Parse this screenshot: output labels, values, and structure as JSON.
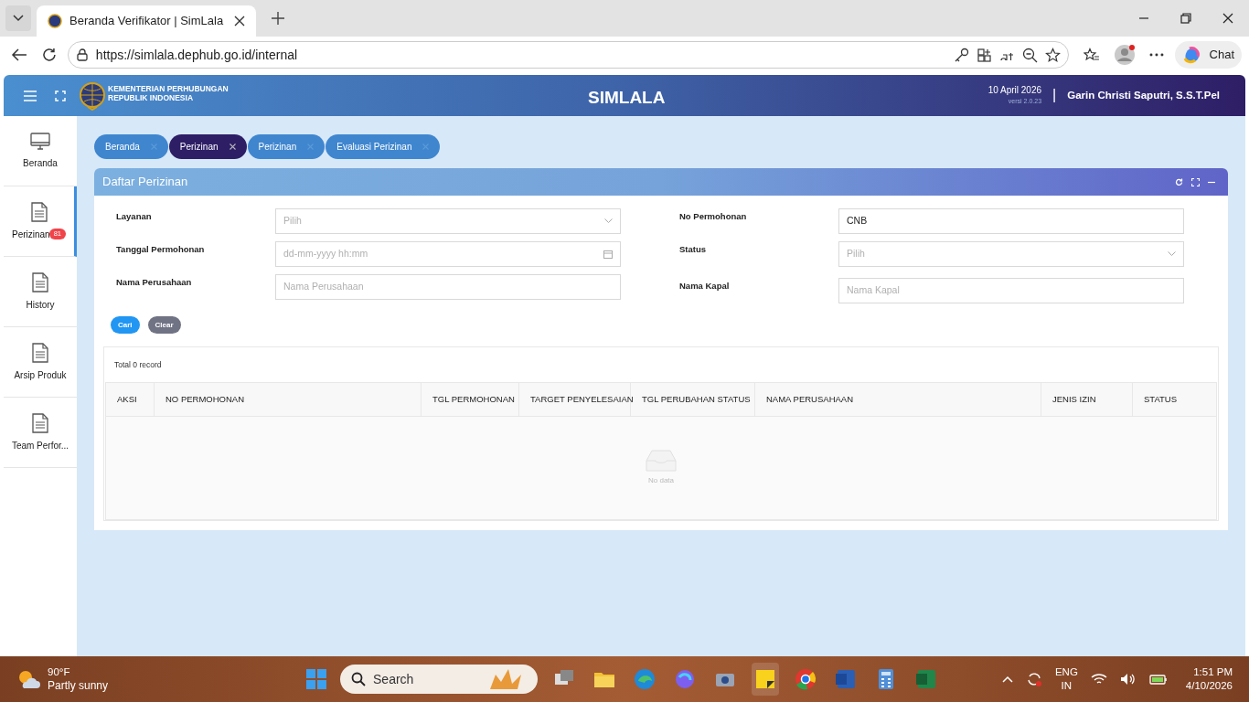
{
  "browser": {
    "tab_title": "Beranda Verifikator | SimLala",
    "url": "https://simlala.dephub.go.id/internal",
    "chat_label": "Chat"
  },
  "header": {
    "org_line1": "KEMENTERIAN PERHUBUNGAN",
    "org_line2": "REPUBLIK INDONESIA",
    "app_title": "SIMLALA",
    "date": "10 April 2026",
    "version": "versi 2.0.23",
    "separator": "|",
    "user": "Garin Christi Saputri, S.S.T.Pel"
  },
  "sidebar": {
    "items": [
      {
        "label": "Beranda",
        "kind": "monitor",
        "selected": false
      },
      {
        "label": "Perizinan",
        "kind": "document",
        "selected": true,
        "badge": "81"
      },
      {
        "label": "History",
        "kind": "document",
        "selected": false
      },
      {
        "label": "Arsip Produk",
        "kind": "document",
        "selected": false
      },
      {
        "label": "Team Perfor...",
        "kind": "document",
        "selected": false
      }
    ]
  },
  "tabs": [
    {
      "label": "Beranda",
      "selected": false
    },
    {
      "label": "Perizinan",
      "selected": true
    },
    {
      "label": "Perizinan",
      "selected": false
    },
    {
      "label": "Evaluasi Perizinan",
      "selected": false
    }
  ],
  "panel": {
    "title": "Daftar Perizinan",
    "left_fields": [
      {
        "label": "Layanan",
        "kind": "select",
        "placeholder": "Pilih"
      },
      {
        "label": "Tanggal Permohonan",
        "kind": "date",
        "placeholder": "dd-mm-yyyy hh:mm"
      },
      {
        "label": "Nama Perusahaan",
        "kind": "text",
        "placeholder": "Nama Perusahaan"
      }
    ],
    "right_fields": [
      {
        "label": "No Permohonan",
        "kind": "text",
        "value": "CNB"
      },
      {
        "label": "Status",
        "kind": "select",
        "placeholder": "Pilih"
      },
      {
        "label": "Nama Kapal",
        "kind": "text",
        "placeholder": "Nama Kapal"
      }
    ],
    "buttons": [
      {
        "label": "Cari",
        "kind": "primary"
      },
      {
        "label": "Clear",
        "kind": "secondary"
      }
    ],
    "table": {
      "total": "Total 0 record",
      "columns": [
        "AKSI",
        "NO PERMOHONAN",
        "TGL PERMOHONAN",
        "TARGET PENYELESAIAN",
        "TGL PERUBAHAN STATUS",
        "NAMA PERUSAHAAN",
        "JENIS IZIN",
        "STATUS"
      ],
      "empty_text": "No data"
    }
  },
  "taskbar": {
    "weather_temp": "90°F",
    "weather_text": "Partly sunny",
    "search_placeholder": "Search",
    "lang_top": "ENG",
    "lang_bottom": "IN",
    "time": "1:51 PM",
    "date": "4/10/2026"
  }
}
